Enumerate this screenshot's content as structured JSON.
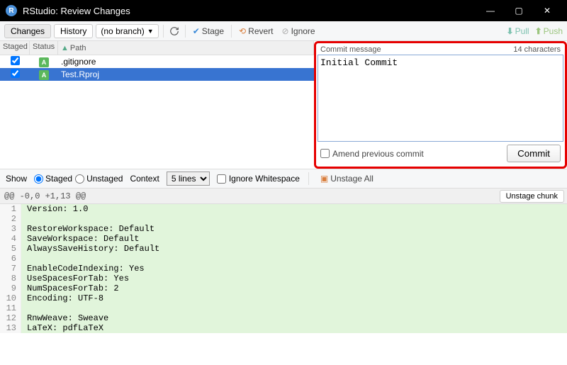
{
  "window": {
    "title": "RStudio: Review Changes"
  },
  "toolbar": {
    "tab_changes": "Changes",
    "tab_history": "History",
    "branch": "(no branch)",
    "stage": "Stage",
    "revert": "Revert",
    "ignore": "Ignore",
    "pull": "Pull",
    "push": "Push"
  },
  "file_header": {
    "staged": "Staged",
    "status": "Status",
    "path": "Path"
  },
  "files": [
    {
      "staged": true,
      "status": "A",
      "path": ".gitignore",
      "selected": false
    },
    {
      "staged": true,
      "status": "A",
      "path": "Test.Rproj",
      "selected": true
    }
  ],
  "commit": {
    "label": "Commit message",
    "chars": "14 characters",
    "message": "Initial Commit",
    "amend": "Amend previous commit",
    "button": "Commit"
  },
  "diff_toolbar": {
    "show": "Show",
    "staged": "Staged",
    "unstaged": "Unstaged",
    "context": "Context",
    "context_val": "5 lines",
    "ignore_ws": "Ignore Whitespace",
    "unstage_all": "Unstage All"
  },
  "hunk": {
    "header": "@@ -0,0 +1,13 @@",
    "btn": "Unstage chunk"
  },
  "diff_lines": [
    {
      "n": 1,
      "t": "Version: 1.0"
    },
    {
      "n": 2,
      "t": ""
    },
    {
      "n": 3,
      "t": "RestoreWorkspace: Default"
    },
    {
      "n": 4,
      "t": "SaveWorkspace: Default"
    },
    {
      "n": 5,
      "t": "AlwaysSaveHistory: Default"
    },
    {
      "n": 6,
      "t": ""
    },
    {
      "n": 7,
      "t": "EnableCodeIndexing: Yes"
    },
    {
      "n": 8,
      "t": "UseSpacesForTab: Yes"
    },
    {
      "n": 9,
      "t": "NumSpacesForTab: 2"
    },
    {
      "n": 10,
      "t": "Encoding: UTF-8"
    },
    {
      "n": 11,
      "t": ""
    },
    {
      "n": 12,
      "t": "RnwWeave: Sweave"
    },
    {
      "n": 13,
      "t": "LaTeX: pdfLaTeX"
    }
  ]
}
